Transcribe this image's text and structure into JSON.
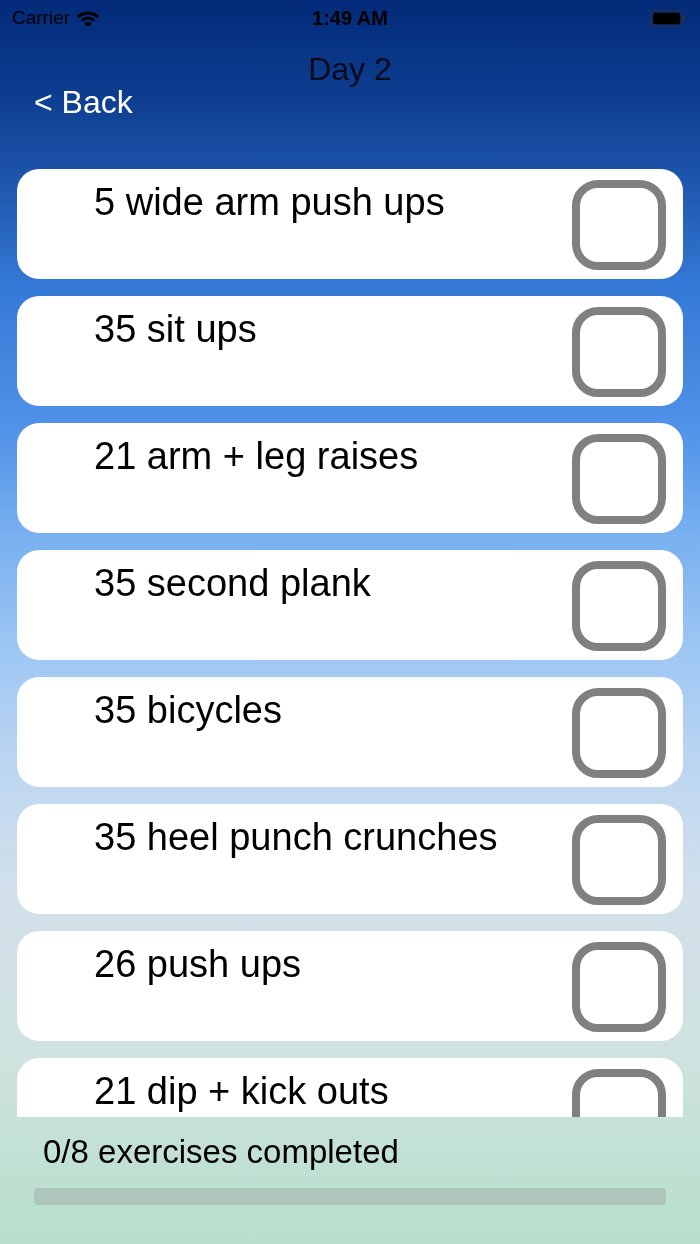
{
  "status_bar": {
    "carrier": "Carrier",
    "time": "1:49 AM"
  },
  "nav": {
    "title": "Day 2",
    "back": "< Back"
  },
  "exercises": [
    {
      "name": "5 wide arm push ups",
      "checked": false
    },
    {
      "name": "35 sit ups",
      "checked": false
    },
    {
      "name": "21 arm + leg raises",
      "checked": false
    },
    {
      "name": "35 second plank",
      "checked": false
    },
    {
      "name": "35 bicycles",
      "checked": false
    },
    {
      "name": "35 heel punch crunches",
      "checked": false
    },
    {
      "name": "26 push ups",
      "checked": false
    },
    {
      "name": "21 dip + kick outs",
      "checked": false
    }
  ],
  "footer": {
    "summary": "0/8 exercises completed",
    "level": 0
  }
}
